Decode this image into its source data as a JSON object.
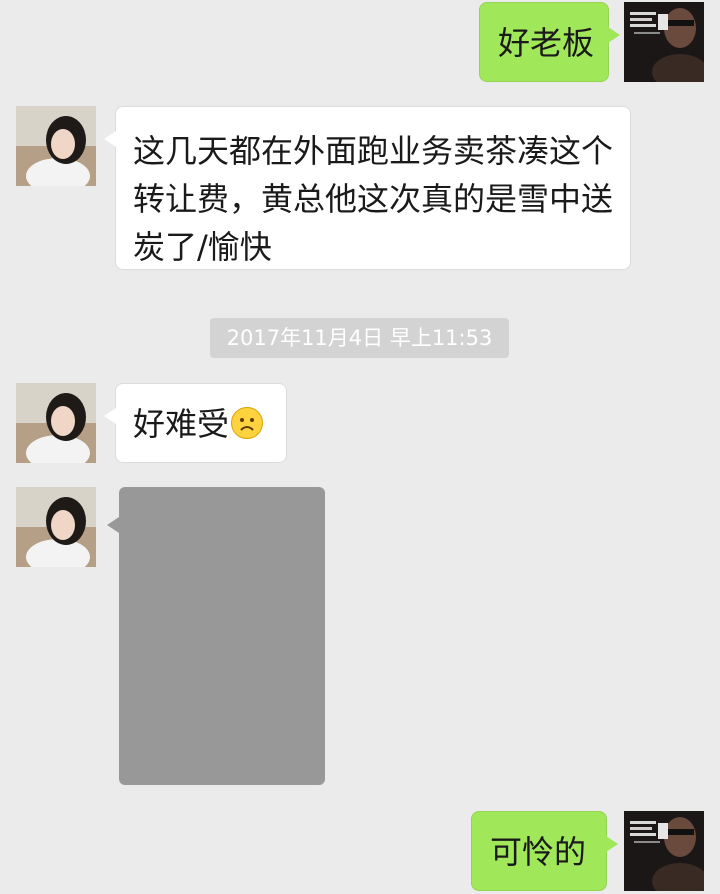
{
  "messages": [
    {
      "side": "out",
      "text": "好老板"
    },
    {
      "side": "in",
      "lines": [
        "这几天都在外面跑业务卖茶凑这个",
        "转让费，黄总他这次真的是雪中送",
        "炭了/愉快"
      ]
    },
    {
      "side": "in",
      "text": "好难受"
    },
    {
      "side": "in",
      "type": "image"
    },
    {
      "side": "out",
      "text": "可怜的"
    }
  ],
  "timestamp": "2017年11月4日 早上11:53",
  "emoji": {
    "name": "sad-face-emoji",
    "color": "#ffd23f"
  },
  "colors": {
    "background": "#ebebeb",
    "outgoing_bubble": "#a0e75a",
    "incoming_bubble": "#ffffff",
    "timestamp_pill": "#d3d3d3",
    "image_placeholder": "#989898"
  }
}
